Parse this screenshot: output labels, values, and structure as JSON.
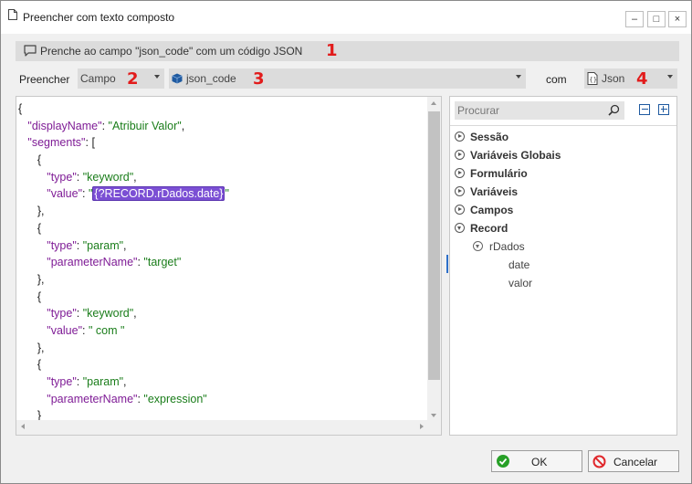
{
  "window": {
    "title": "Preencher com texto composto",
    "controls": {
      "minimize": "–",
      "maximize": "□",
      "close": "×"
    }
  },
  "info": {
    "message": "Prenche ao campo \"json_code\" com um código JSON",
    "icon": "speech-bubble-icon",
    "marker": "1"
  },
  "toolbar": {
    "fill_label": "Preencher",
    "type_combo": {
      "value": "Campo",
      "marker": "2"
    },
    "field_combo": {
      "value": "json_code",
      "icon": "cube-icon",
      "marker": "3"
    },
    "with_label": "com",
    "format_combo": {
      "value": "Json",
      "icon": "json-file-icon",
      "marker": "4"
    }
  },
  "editor": {
    "lines": [
      {
        "indent": "",
        "parts": [
          {
            "c": "p",
            "t": "{"
          }
        ]
      },
      {
        "indent": "   ",
        "parts": [
          {
            "c": "k",
            "t": "\"displayName\""
          },
          {
            "c": "p",
            "t": ": "
          },
          {
            "c": "s",
            "t": "\"Atribuir Valor\""
          },
          {
            "c": "p",
            "t": ","
          }
        ]
      },
      {
        "indent": "   ",
        "parts": [
          {
            "c": "k",
            "t": "\"segments\""
          },
          {
            "c": "p",
            "t": ": ["
          }
        ]
      },
      {
        "indent": "      ",
        "parts": [
          {
            "c": "p",
            "t": "{"
          }
        ]
      },
      {
        "indent": "         ",
        "parts": [
          {
            "c": "k",
            "t": "\"type\""
          },
          {
            "c": "p",
            "t": ": "
          },
          {
            "c": "s",
            "t": "\"keyword\""
          },
          {
            "c": "p",
            "t": ","
          }
        ]
      },
      {
        "indent": "         ",
        "parts": [
          {
            "c": "k",
            "t": "\"value\""
          },
          {
            "c": "p",
            "t": ": "
          },
          {
            "c": "s",
            "t": "\""
          },
          {
            "c": "hl",
            "t": "{?RECORD.rDados.date}"
          },
          {
            "c": "s",
            "t": "\""
          }
        ]
      },
      {
        "indent": "      ",
        "parts": [
          {
            "c": "p",
            "t": "},"
          }
        ]
      },
      {
        "indent": "      ",
        "parts": [
          {
            "c": "p",
            "t": "{"
          }
        ]
      },
      {
        "indent": "         ",
        "parts": [
          {
            "c": "k",
            "t": "\"type\""
          },
          {
            "c": "p",
            "t": ": "
          },
          {
            "c": "s",
            "t": "\"param\""
          },
          {
            "c": "p",
            "t": ","
          }
        ]
      },
      {
        "indent": "         ",
        "parts": [
          {
            "c": "k",
            "t": "\"parameterName\""
          },
          {
            "c": "p",
            "t": ": "
          },
          {
            "c": "s",
            "t": "\"target\""
          }
        ]
      },
      {
        "indent": "      ",
        "parts": [
          {
            "c": "p",
            "t": "},"
          }
        ]
      },
      {
        "indent": "      ",
        "parts": [
          {
            "c": "p",
            "t": "{"
          }
        ]
      },
      {
        "indent": "         ",
        "parts": [
          {
            "c": "k",
            "t": "\"type\""
          },
          {
            "c": "p",
            "t": ": "
          },
          {
            "c": "s",
            "t": "\"keyword\""
          },
          {
            "c": "p",
            "t": ","
          }
        ]
      },
      {
        "indent": "         ",
        "parts": [
          {
            "c": "k",
            "t": "\"value\""
          },
          {
            "c": "p",
            "t": ": "
          },
          {
            "c": "s",
            "t": "\" com \""
          }
        ]
      },
      {
        "indent": "      ",
        "parts": [
          {
            "c": "p",
            "t": "},"
          }
        ]
      },
      {
        "indent": "      ",
        "parts": [
          {
            "c": "p",
            "t": "{"
          }
        ]
      },
      {
        "indent": "         ",
        "parts": [
          {
            "c": "k",
            "t": "\"type\""
          },
          {
            "c": "p",
            "t": ": "
          },
          {
            "c": "s",
            "t": "\"param\""
          },
          {
            "c": "p",
            "t": ","
          }
        ]
      },
      {
        "indent": "         ",
        "parts": [
          {
            "c": "k",
            "t": "\"parameterName\""
          },
          {
            "c": "p",
            "t": ": "
          },
          {
            "c": "s",
            "t": "\"expression\""
          }
        ]
      },
      {
        "indent": "      ",
        "parts": [
          {
            "c": "p",
            "t": "}"
          }
        ]
      }
    ]
  },
  "side_panel": {
    "search_placeholder": "Procurar",
    "tree": [
      {
        "label": "Sessão",
        "expanded": false
      },
      {
        "label": "Variáveis Globais",
        "expanded": false
      },
      {
        "label": "Formulário",
        "expanded": false
      },
      {
        "label": "Variáveis",
        "expanded": false
      },
      {
        "label": "Campos",
        "expanded": false
      },
      {
        "label": "Record",
        "expanded": true
      }
    ],
    "record_child": {
      "label": "rDados",
      "expanded": true,
      "children": [
        "date",
        "valor"
      ]
    }
  },
  "buttons": {
    "ok": "OK",
    "cancel": "Cancelar"
  },
  "colors": {
    "marker": "#e21b1b",
    "highlight": "#7b4fd4",
    "json_key": "#7f1c96",
    "json_string": "#1a7d1a"
  }
}
